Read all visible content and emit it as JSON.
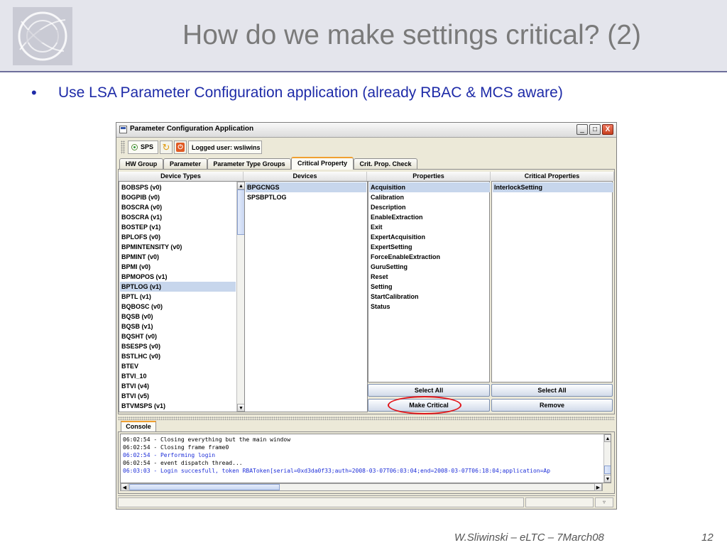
{
  "slide": {
    "title": "How do we make settings critical? (2)",
    "bullet": "Use LSA Parameter Configuration application (already RBAC & MCS aware)",
    "footer_credit": "W.Sliwinski – eLTC – 7March08",
    "page_number": "12"
  },
  "window": {
    "title": "Parameter Configuration Application",
    "controls": {
      "minimize": "_",
      "maximize": "□",
      "close": "X"
    }
  },
  "toolbar": {
    "accelerator": "SPS",
    "user_label": "Logged user: wsliwins",
    "power_glyph": "⏻"
  },
  "tabs": [
    {
      "label": "HW Group"
    },
    {
      "label": "Parameter"
    },
    {
      "label": "Parameter Type Groups"
    },
    {
      "label": "Critical Property",
      "active": true
    },
    {
      "label": "Crit. Prop. Check"
    }
  ],
  "columns": {
    "device_types": {
      "header": "Device Types",
      "items": [
        "BOBSPS (v0)",
        "BOGPIB (v0)",
        "BOSCRA (v0)",
        "BOSCRA (v1)",
        "BOSTEP (v1)",
        "BPLOFS (v0)",
        "BPMINTENSITY (v0)",
        "BPMINT (v0)",
        "BPMI (v0)",
        "BPMOPOS (v1)",
        "BPTLOG (v1)",
        "BPTL (v1)",
        "BQBOSC (v0)",
        "BQSB (v0)",
        "BQSB (v1)",
        "BQSHT (v0)",
        "BSESPS (v0)",
        "BSTLHC (v0)",
        "BTEV",
        "BTVI_10",
        "BTVI (v4)",
        "BTVI (v5)",
        "BTVMSPS (v1)"
      ],
      "selected_index": 10
    },
    "devices": {
      "header": "Devices",
      "items": [
        "BPGCNGS",
        "SPSBPTLOG"
      ],
      "selected_index": 0
    },
    "properties": {
      "header": "Properties",
      "items": [
        "Acquisition",
        "Calibration",
        "Description",
        "EnableExtraction",
        "Exit",
        "ExpertAcquisition",
        "ExpertSetting",
        "ForceEnableExtraction",
        "GuruSetting",
        "Reset",
        "Setting",
        "StartCalibration",
        "Status"
      ],
      "selected_index": 0,
      "buttons": {
        "select_all": "Select All",
        "make_critical": "Make Critical"
      }
    },
    "critical_properties": {
      "header": "Critical Properties",
      "items": [
        "InterlockSetting"
      ],
      "selected_index": 0,
      "buttons": {
        "select_all": "Select All",
        "remove": "Remove"
      }
    }
  },
  "console": {
    "tab_label": "Console",
    "lines": [
      {
        "text": "06:02:54 - Closing everything but the main window",
        "kind": "plain"
      },
      {
        "text": "06:02:54 - Closing frame frame0",
        "kind": "plain"
      },
      {
        "text": "06:02:54 - Performing login",
        "kind": "info"
      },
      {
        "text": "06:02:54 - event dispatch thread...",
        "kind": "plain"
      },
      {
        "text": "06:03:03 - Login succesfull, token RBAToken[serial=0xd3da0f33;auth=2008-03-07T06:03:04;end=2008-03-07T06:18:04;application=Ap",
        "kind": "info"
      }
    ]
  },
  "colors": {
    "bullet_text": "#1e2ba8",
    "selection": "#c7d6ec",
    "active_tab_accent": "#f0a030",
    "highlight_ring": "#e0151a"
  }
}
